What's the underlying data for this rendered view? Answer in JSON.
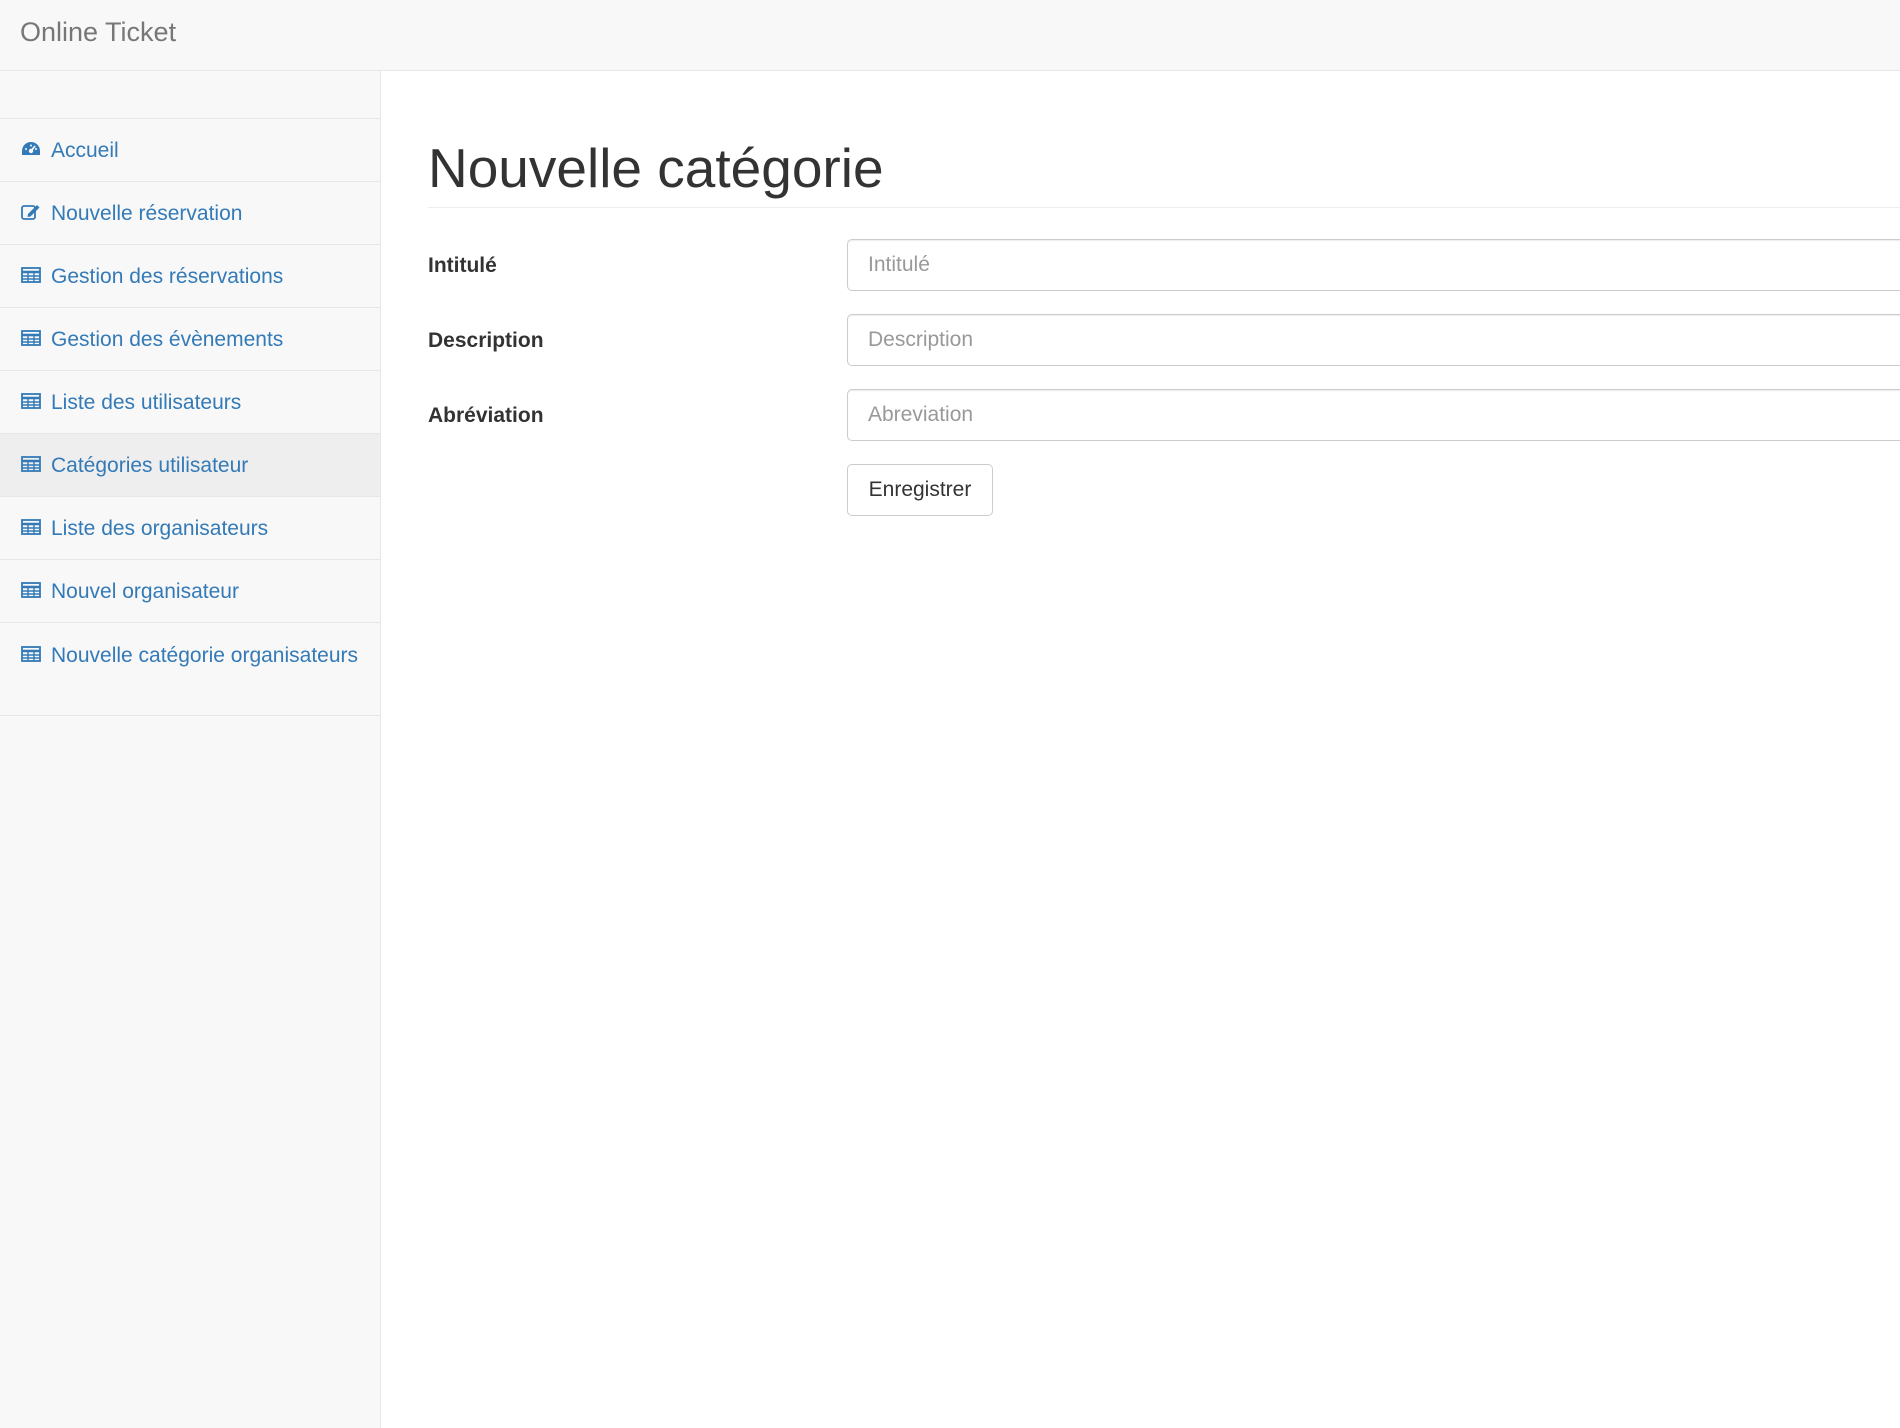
{
  "navbar": {
    "brand": "Online Ticket"
  },
  "sidebar": {
    "items": [
      {
        "label": "Accueil",
        "icon": "dashboard-icon",
        "active": false
      },
      {
        "label": "Nouvelle réservation",
        "icon": "edit-icon",
        "active": false
      },
      {
        "label": "Gestion des réservations",
        "icon": "table-icon",
        "active": false
      },
      {
        "label": "Gestion des évènements",
        "icon": "table-icon",
        "active": false
      },
      {
        "label": "Liste des utilisateurs",
        "icon": "table-icon",
        "active": false
      },
      {
        "label": "Catégories utilisateur",
        "icon": "table-icon",
        "active": true
      },
      {
        "label": "Liste des organisateurs",
        "icon": "table-icon",
        "active": false
      },
      {
        "label": "Nouvel organisateur",
        "icon": "table-icon",
        "active": false
      },
      {
        "label": "Nouvelle catégorie organisateurs",
        "icon": "table-icon",
        "active": false
      }
    ]
  },
  "main": {
    "title": "Nouvelle catégorie",
    "form": {
      "fields": [
        {
          "label": "Intitulé",
          "placeholder": "Intitulé",
          "value": ""
        },
        {
          "label": "Description",
          "placeholder": "Description",
          "value": ""
        },
        {
          "label": "Abréviation",
          "placeholder": "Abreviation",
          "value": ""
        }
      ],
      "submit_label": "Enregistrer"
    }
  },
  "colors": {
    "link": "#337ab7",
    "navbar_bg": "#f8f8f8",
    "active_item_bg": "#eeeeee",
    "border": "#e7e7e7"
  }
}
